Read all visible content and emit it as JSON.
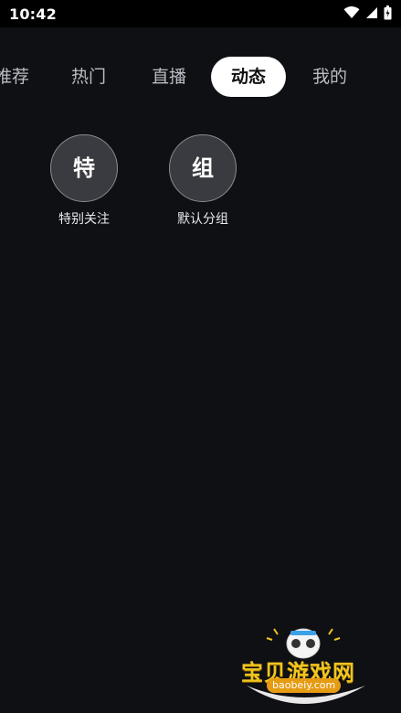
{
  "status_bar": {
    "time": "10:42",
    "icons": [
      "wifi-icon",
      "signal-icon",
      "battery-charging-icon"
    ]
  },
  "tabs": [
    {
      "label": "推荐",
      "active": false
    },
    {
      "label": "热门",
      "active": false
    },
    {
      "label": "直播",
      "active": false
    },
    {
      "label": "动态",
      "active": true
    },
    {
      "label": "我的",
      "active": false
    }
  ],
  "groups": [
    {
      "glyph": "特",
      "label": "特别关注"
    },
    {
      "glyph": "组",
      "label": "默认分组"
    }
  ],
  "watermark": {
    "text": "宝贝游戏网",
    "url": "baobeiy.com"
  },
  "colors": {
    "background": "#0f1014",
    "status_bar": "#000000",
    "tab_active_bg": "#ffffff",
    "tab_inactive_text": "#b9bcc3",
    "circle_bg": "#3a3b40",
    "watermark_gold": "#f2c51e"
  }
}
